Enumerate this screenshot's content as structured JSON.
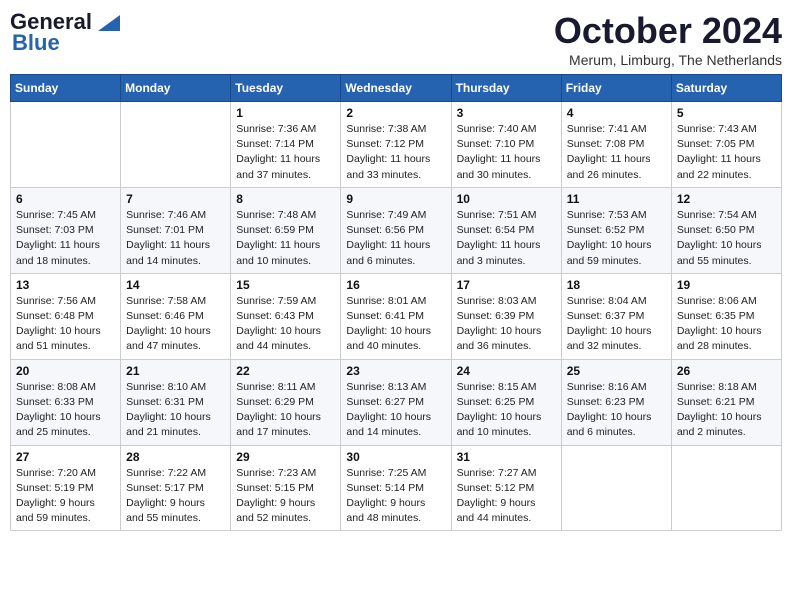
{
  "logo": {
    "line1": "General",
    "line2": "Blue"
  },
  "title": "October 2024",
  "location": "Merum, Limburg, The Netherlands",
  "days_of_week": [
    "Sunday",
    "Monday",
    "Tuesday",
    "Wednesday",
    "Thursday",
    "Friday",
    "Saturday"
  ],
  "weeks": [
    [
      {
        "day": "",
        "info": ""
      },
      {
        "day": "",
        "info": ""
      },
      {
        "day": "1",
        "info": "Sunrise: 7:36 AM\nSunset: 7:14 PM\nDaylight: 11 hours\nand 37 minutes."
      },
      {
        "day": "2",
        "info": "Sunrise: 7:38 AM\nSunset: 7:12 PM\nDaylight: 11 hours\nand 33 minutes."
      },
      {
        "day": "3",
        "info": "Sunrise: 7:40 AM\nSunset: 7:10 PM\nDaylight: 11 hours\nand 30 minutes."
      },
      {
        "day": "4",
        "info": "Sunrise: 7:41 AM\nSunset: 7:08 PM\nDaylight: 11 hours\nand 26 minutes."
      },
      {
        "day": "5",
        "info": "Sunrise: 7:43 AM\nSunset: 7:05 PM\nDaylight: 11 hours\nand 22 minutes."
      }
    ],
    [
      {
        "day": "6",
        "info": "Sunrise: 7:45 AM\nSunset: 7:03 PM\nDaylight: 11 hours\nand 18 minutes."
      },
      {
        "day": "7",
        "info": "Sunrise: 7:46 AM\nSunset: 7:01 PM\nDaylight: 11 hours\nand 14 minutes."
      },
      {
        "day": "8",
        "info": "Sunrise: 7:48 AM\nSunset: 6:59 PM\nDaylight: 11 hours\nand 10 minutes."
      },
      {
        "day": "9",
        "info": "Sunrise: 7:49 AM\nSunset: 6:56 PM\nDaylight: 11 hours\nand 6 minutes."
      },
      {
        "day": "10",
        "info": "Sunrise: 7:51 AM\nSunset: 6:54 PM\nDaylight: 11 hours\nand 3 minutes."
      },
      {
        "day": "11",
        "info": "Sunrise: 7:53 AM\nSunset: 6:52 PM\nDaylight: 10 hours\nand 59 minutes."
      },
      {
        "day": "12",
        "info": "Sunrise: 7:54 AM\nSunset: 6:50 PM\nDaylight: 10 hours\nand 55 minutes."
      }
    ],
    [
      {
        "day": "13",
        "info": "Sunrise: 7:56 AM\nSunset: 6:48 PM\nDaylight: 10 hours\nand 51 minutes."
      },
      {
        "day": "14",
        "info": "Sunrise: 7:58 AM\nSunset: 6:46 PM\nDaylight: 10 hours\nand 47 minutes."
      },
      {
        "day": "15",
        "info": "Sunrise: 7:59 AM\nSunset: 6:43 PM\nDaylight: 10 hours\nand 44 minutes."
      },
      {
        "day": "16",
        "info": "Sunrise: 8:01 AM\nSunset: 6:41 PM\nDaylight: 10 hours\nand 40 minutes."
      },
      {
        "day": "17",
        "info": "Sunrise: 8:03 AM\nSunset: 6:39 PM\nDaylight: 10 hours\nand 36 minutes."
      },
      {
        "day": "18",
        "info": "Sunrise: 8:04 AM\nSunset: 6:37 PM\nDaylight: 10 hours\nand 32 minutes."
      },
      {
        "day": "19",
        "info": "Sunrise: 8:06 AM\nSunset: 6:35 PM\nDaylight: 10 hours\nand 28 minutes."
      }
    ],
    [
      {
        "day": "20",
        "info": "Sunrise: 8:08 AM\nSunset: 6:33 PM\nDaylight: 10 hours\nand 25 minutes."
      },
      {
        "day": "21",
        "info": "Sunrise: 8:10 AM\nSunset: 6:31 PM\nDaylight: 10 hours\nand 21 minutes."
      },
      {
        "day": "22",
        "info": "Sunrise: 8:11 AM\nSunset: 6:29 PM\nDaylight: 10 hours\nand 17 minutes."
      },
      {
        "day": "23",
        "info": "Sunrise: 8:13 AM\nSunset: 6:27 PM\nDaylight: 10 hours\nand 14 minutes."
      },
      {
        "day": "24",
        "info": "Sunrise: 8:15 AM\nSunset: 6:25 PM\nDaylight: 10 hours\nand 10 minutes."
      },
      {
        "day": "25",
        "info": "Sunrise: 8:16 AM\nSunset: 6:23 PM\nDaylight: 10 hours\nand 6 minutes."
      },
      {
        "day": "26",
        "info": "Sunrise: 8:18 AM\nSunset: 6:21 PM\nDaylight: 10 hours\nand 2 minutes."
      }
    ],
    [
      {
        "day": "27",
        "info": "Sunrise: 7:20 AM\nSunset: 5:19 PM\nDaylight: 9 hours\nand 59 minutes."
      },
      {
        "day": "28",
        "info": "Sunrise: 7:22 AM\nSunset: 5:17 PM\nDaylight: 9 hours\nand 55 minutes."
      },
      {
        "day": "29",
        "info": "Sunrise: 7:23 AM\nSunset: 5:15 PM\nDaylight: 9 hours\nand 52 minutes."
      },
      {
        "day": "30",
        "info": "Sunrise: 7:25 AM\nSunset: 5:14 PM\nDaylight: 9 hours\nand 48 minutes."
      },
      {
        "day": "31",
        "info": "Sunrise: 7:27 AM\nSunset: 5:12 PM\nDaylight: 9 hours\nand 44 minutes."
      },
      {
        "day": "",
        "info": ""
      },
      {
        "day": "",
        "info": ""
      }
    ]
  ]
}
